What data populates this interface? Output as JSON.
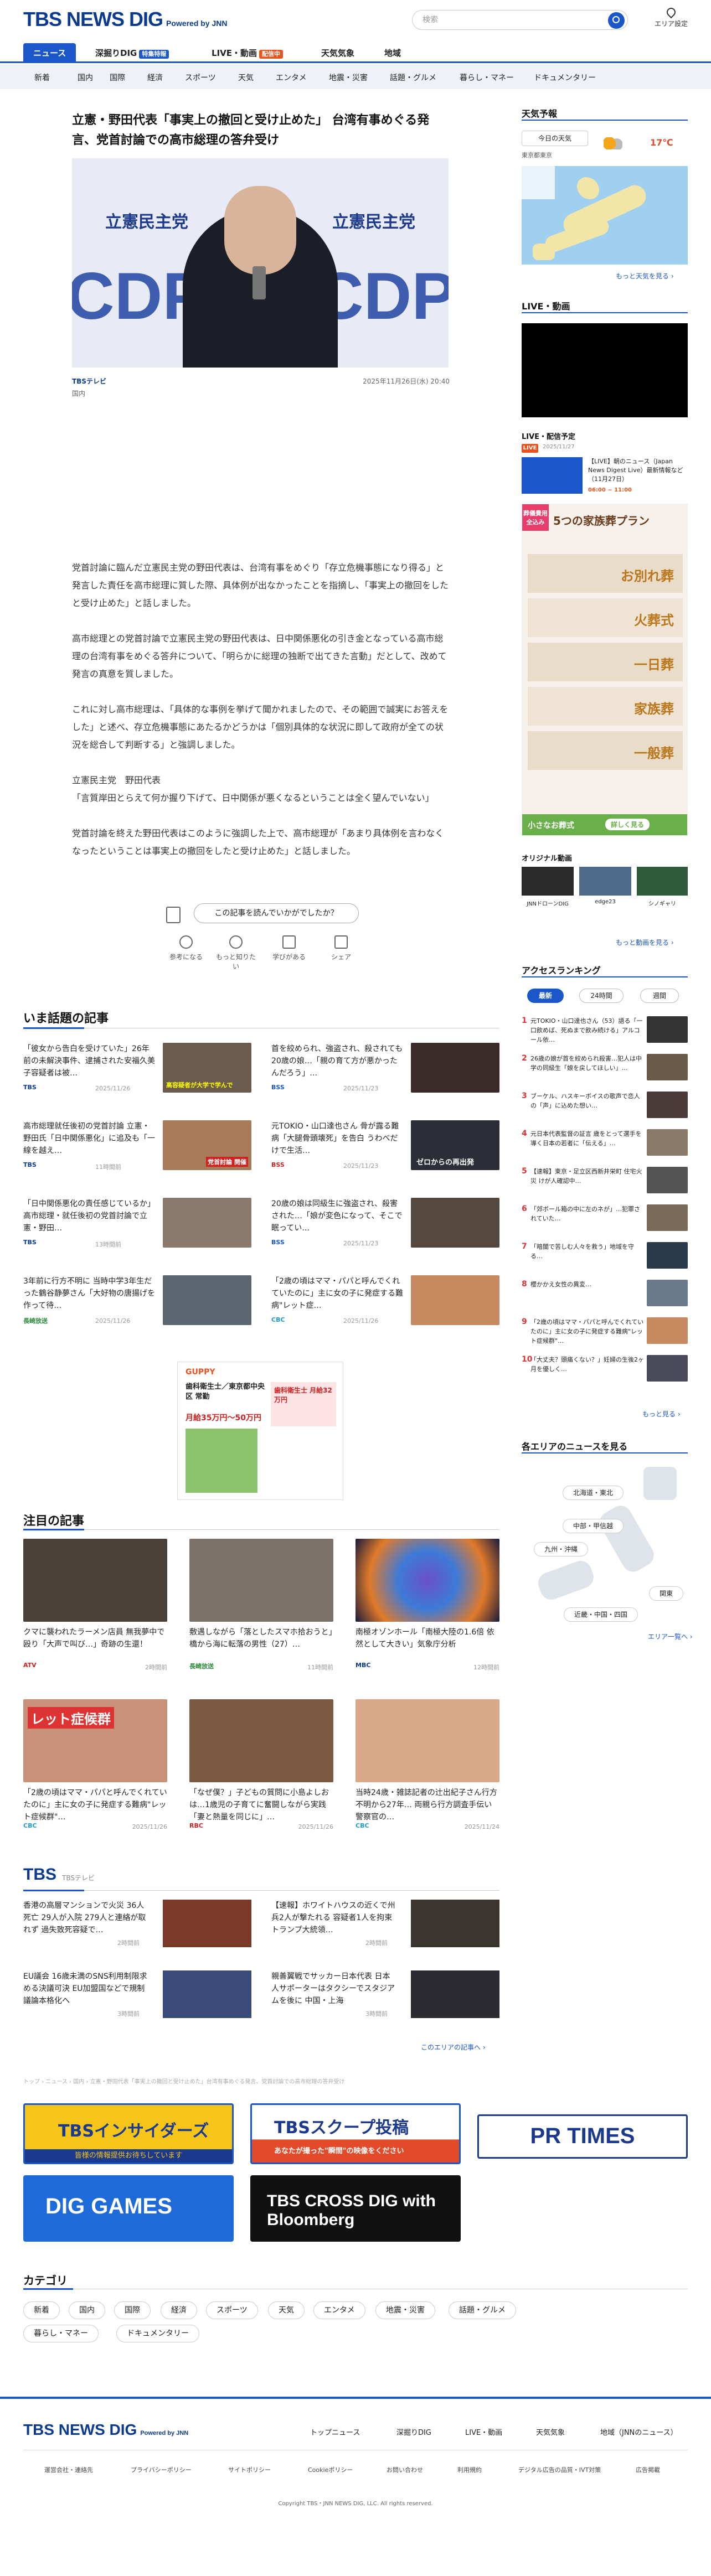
{
  "header": {
    "logo": "TBS NEWS DIG",
    "logo_sub": "Powered by JNN",
    "search_placeholder": "検索",
    "area_setting": "エリア設定"
  },
  "nav_main": [
    {
      "label": "ニュース",
      "active": true
    },
    {
      "label": "深掘りDIG",
      "badge": "特集特報"
    },
    {
      "label": "LIVE・動画",
      "badge": "配信中"
    },
    {
      "label": "天気気象"
    },
    {
      "label": "地域"
    }
  ],
  "nav_sub": [
    "新着",
    "国内",
    "国際",
    "経済",
    "スポーツ",
    "天気",
    "エンタメ",
    "地震・災害",
    "話題・グルメ",
    "暮らし・マネー",
    "ドキュメンタリー"
  ],
  "article": {
    "title": "立憲・野田代表「事実上の撤回と受け止めた」 台湾有事めぐる発言、党首討論での高市総理の答弁受け",
    "hero_banner_left": "立憲民主党",
    "hero_banner_right": "立憲民主党",
    "hero_logo_text": "CDP",
    "source": "TBSテレビ",
    "date": "2025年11月26日(水) 20:40",
    "category": "国内",
    "paragraphs": [
      "党首討論に臨んだ立憲民主党の野田代表は、台湾有事をめぐり「存立危機事態になり得る」と発言した責任を高市総理に質した際、具体例が出なかったことを指摘し、「事実上の撤回をしたと受け止めた」と話しました。",
      "高市総理との党首討論で立憲民主党の野田代表は、日中関係悪化の引き金となっている高市総理の台湾有事をめぐる答弁について、「明らかに総理の独断で出てきた言動」だとして、改めて発言の真意を質しました。",
      "これに対し高市総理は、「具体的な事例を挙げて聞かれましたので、その範囲で誠実にお答えをした」と述べ、存立危機事態にあたるかどうかは「個別具体的な状況に即して政府が全ての状況を総合して判断する」と強調しました。",
      "立憲民主党　野田代表\n「言質岸田とらえて何か握り下げて、日中関係が悪くなるということは全く望んでいない」",
      "党首討論を終えた野田代表はこのように強調した上で、高市総理が「あまり具体例を言わなくなったということは事実上の撤回をしたと受け止めた」と話しました。"
    ],
    "feedback_prompt": "この記事を読んでいかがでしたか？",
    "reactions": [
      "参考になる",
      "もっと知りたい",
      "学びがある",
      "シェア"
    ]
  },
  "trending": {
    "title": "いま話題の記事",
    "items": [
      {
        "text": "「彼女から告白を受けていた」26年前の未解決事件、逮捕された安福久美子容疑者は被…",
        "src": "TBS",
        "date": "2025/11/26",
        "thumb_text": "高容疑者が大学で学んで"
      },
      {
        "text": "首を絞められ、強盗され、殺されても20歳の娘…「親の育て方が悪かったんだろう」…",
        "src": "BSS",
        "date": "2025/11/23",
        "thumb_text": ""
      },
      {
        "text": "高市総理就任後初の党首討論 立憲・野田氏「日中関係悪化」に追及も「一線を越え…",
        "src": "TBS",
        "date": "11時間前",
        "thumb_text": "党首討論 開催"
      },
      {
        "text": "元TOKIO・山口達也さん 骨が露る難病「大腿骨頭壊死」を告白 うわべだけで生活…",
        "src": "BSS",
        "date": "2025/11/23",
        "thumb_text": "ゼロからの再出発"
      },
      {
        "text": "「日中関係悪化の責任感じているか」高市総理・就任後初の党首討論で立憲・野田…",
        "src": "TBS",
        "date": "13時間前",
        "thumb_text": ""
      },
      {
        "text": "20歳の娘は同級生に強盗され、殺害された…「娘が変色になって、そこで眠ってい…",
        "src": "BSS",
        "date": "2025/11/23",
        "thumb_text": ""
      },
      {
        "text": "3年前に行方不明に 当時中学3年生だった鶴谷静夢さん「大好物の唐揚げを作って待…",
        "src": "長崎放送",
        "date": "2025/11/26",
        "thumb_text": ""
      },
      {
        "text": "「2歳の頃はママ・パパと呼んでくれていたのに」主に女の子に発症する難病\"レット症…",
        "src": "CBC",
        "date": "2025/11/26",
        "thumb_text": ""
      }
    ]
  },
  "ad_mid": {
    "brand": "GUPPY",
    "head": "歯科衛生士／東京都中央区 常勤",
    "pay": "月給35万円〜50万円",
    "pay2": "歯科衛生士 月給32万円"
  },
  "featured": {
    "title": "注目の記事",
    "cards": [
      {
        "text": "クマに襲われたラーメン店員 無我夢中で殴り「大声で叫び…」奇跡の生還！",
        "src": "ATV",
        "date": "2時間前"
      },
      {
        "text": "敷遇しながら「落としたスマホ拾おうと」橋から海に転落の男性（27）…",
        "src": "長崎放送",
        "date": "11時間前"
      },
      {
        "text": "南極オゾンホール「南極大陸の1.6倍 依然として大きい」気象庁分析",
        "src": "MBC",
        "date": "12時間前"
      },
      {
        "text": "「2歳の頃はママ・パパと呼んでくれていたのに」主に女の子に発症する難病\"レット症候群\"…",
        "src": "CBC",
        "date": "2025/11/26"
      },
      {
        "text": "「なぜ僕？」子どもの質問に小島よしおは…1歳児の子育てに奮闘しながら実践「妻と熱量を同じに」…",
        "src": "RBC",
        "date": "2025/11/26"
      },
      {
        "text": "当時24歳・雑誌記者の辻出紀子さん行方不明から27年… 両親ら行方調査手伝い 警察官の…",
        "src": "CBC",
        "date": "2025/11/24"
      }
    ],
    "card_overlay": "レット症候群"
  },
  "tbs_section": {
    "title": "TBS",
    "subtitle": "TBSテレビ",
    "items": [
      {
        "text": "香港の高層マンションで火災 36人死亡 29人が入院 279人と連絡が取れず 過失致死容疑で…",
        "date": "2時間前"
      },
      {
        "text": "【速報】ホワイトハウスの近くで州兵2人が撃たれる 容疑者1人を拘束 トランプ大統領…",
        "date": "2時間前"
      },
      {
        "text": "EU議会 16歳未満のSNS利用制限求める決議可決 EU加盟国などで規制議論本格化へ",
        "date": "3時間前"
      },
      {
        "text": "親善翼戦でサッカー日本代表 日本人サポーターはタクシーでスタジアムを後に 中国・上海",
        "date": "3時間前"
      }
    ],
    "more": "このエリアの記事へ ›"
  },
  "breadcrumb": "トップ › ニュース › 国内 › 立憲・野田代表「事実上の撤回と受け止めた」台湾有事めぐる発言、党首討論での高市総理の答弁受け",
  "banners": [
    {
      "label": "TBSインサイダーズ",
      "sub": "皆様の情報提供お待ちしています",
      "color": "#f7c51a"
    },
    {
      "label": "TBSスクープ投稿",
      "sub": "あなたが撮った\"瞬間\"の映像をください",
      "color": "#2b5cb8"
    },
    {
      "label": "PR TIMES",
      "color": "#fff"
    },
    {
      "label": "DIG GAMES",
      "color": "#1e6ad8"
    },
    {
      "label": "TBS CROSS DIG with Bloomberg",
      "color": "#111"
    }
  ],
  "categories": {
    "title": "カテゴリ",
    "items": [
      "新着",
      "国内",
      "国際",
      "経済",
      "スポーツ",
      "天気",
      "エンタメ",
      "地震・災害",
      "話題・グルメ",
      "暮らし・マネー",
      "ドキュメンタリー"
    ]
  },
  "right": {
    "weather_title": "天気予報",
    "weather_today": "今日の天気",
    "weather_place": "東京都東京",
    "weather_temp": "17℃",
    "weather_more": "もっと天気を見る ›",
    "live_title": "LIVE・動画",
    "live_sched_title": "LIVE・配信予定",
    "live_badge": "LIVE",
    "live_date": "2025/11/27",
    "live_item": "【LIVE】朝のニュース（Japan News Digest Live）最新情報など（11月27日）",
    "live_time": "06:00 ~ 11:00",
    "ad_plan": "5つの家族葬プラン",
    "ad_tag": "葬儀費用 全込み",
    "ad_plans": [
      "お別れ葬",
      "火葬式",
      "一日葬",
      "家族葬",
      "一般葬"
    ],
    "ad_cta": "詳しく見る",
    "ad_footer": "小さなお葬式",
    "orig_title": "オリジナル動画",
    "orig_items": [
      "JNNドローンDIG",
      "edge23",
      "シノギャリ"
    ],
    "orig_more": "もっと動画を見る ›",
    "rank_title": "アクセスランキング",
    "rank_tabs": [
      "最新",
      "24時間",
      "週間"
    ],
    "ranks": [
      "元TOKIO・山口達也さん（53）語る「一口飲めば、死ぬまで飲み続ける」アルコール依…",
      "26歳の娘が首を絞められ殺害…犯人は中学の同級生「娘を戻してほしい」…",
      "ブーケル、ハスキーボイスの歌声で恋人の「声」に込めた想い…",
      "元日本代表監督の証言 歳をとって選手を導く日本の若者に「伝える」…",
      "【速報】東京・足立区西新井栄町 住宅火災 けが人確認中…",
      "「郊ボール箱の中に左のネが」…犯罪されていた…",
      "「暗闇で苦しむ人々を救う」地域を守る…",
      "櫻かかえ女性の異変…",
      "「2歳の頃はママ・パパと呼んでくれていたのに」主に女の子に発症する難病\"レット症候群\"…",
      "「大丈夫？頭痛くない？」妊婦の生後2ヶ月を優しく…"
    ],
    "rank_more": "もっと見る ›",
    "area_title": "各エリアのニュースを見る",
    "areas": [
      "北海道・東北",
      "中部・甲信越",
      "九州・沖縄",
      "関東",
      "近畿・中国・四国"
    ],
    "area_more": "エリア一覧へ ›"
  },
  "footer": {
    "logo": "TBS NEWS DIG",
    "logo_sub": "Powered by JNN",
    "links1": [
      "トップニュース",
      "深掘りDIG",
      "LIVE・動画",
      "天気気象",
      "地域（JNNのニュース）"
    ],
    "links2": [
      "運営会社・連絡先",
      "プライバシーポリシー",
      "サイトポリシー",
      "Cookieポリシー",
      "お問い合わせ",
      "利用規約",
      "デジタル広告の品質・IVT対策",
      "広告掲載"
    ],
    "copyright": "Copyright TBS・JNN NEWS DIG, LLC. All rights reserved."
  }
}
